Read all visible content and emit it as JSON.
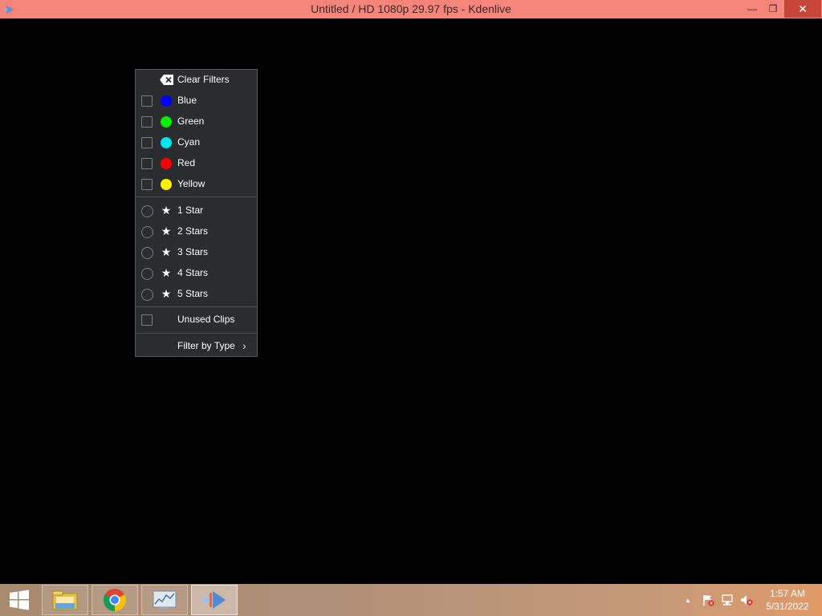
{
  "window": {
    "title": "Untitled / HD 1080p 29.97 fps - Kdenlive",
    "minimize_glyph": "—",
    "restore_glyph": "❐",
    "close_glyph": "✕"
  },
  "menu": {
    "clear_label": "Clear Filters",
    "colors": [
      {
        "label": "Blue",
        "color": "#0000ff"
      },
      {
        "label": "Green",
        "color": "#00ee00"
      },
      {
        "label": "Cyan",
        "color": "#00e5ee"
      },
      {
        "label": "Red",
        "color": "#ff0000"
      },
      {
        "label": "Yellow",
        "color": "#ffee00"
      }
    ],
    "ratings": [
      {
        "label": "1 Star",
        "stars": 1
      },
      {
        "label": "2 Stars",
        "stars": 2
      },
      {
        "label": "3 Stars",
        "stars": 3
      },
      {
        "label": "4 Stars",
        "stars": 4
      },
      {
        "label": "5 Stars",
        "stars": 5
      }
    ],
    "unused_label": "Unused Clips",
    "filter_type_label": "Filter by Type",
    "star_glyph": "★",
    "submenu_arrow": "›"
  },
  "taskbar": {
    "apps": [
      {
        "name": "file-explorer-icon"
      },
      {
        "name": "chrome-icon"
      },
      {
        "name": "performance-monitor-icon"
      },
      {
        "name": "kdenlive-icon",
        "active": true
      }
    ],
    "tray_chevron": "▲",
    "time": "1:57 AM",
    "date": "5/31/2022"
  }
}
